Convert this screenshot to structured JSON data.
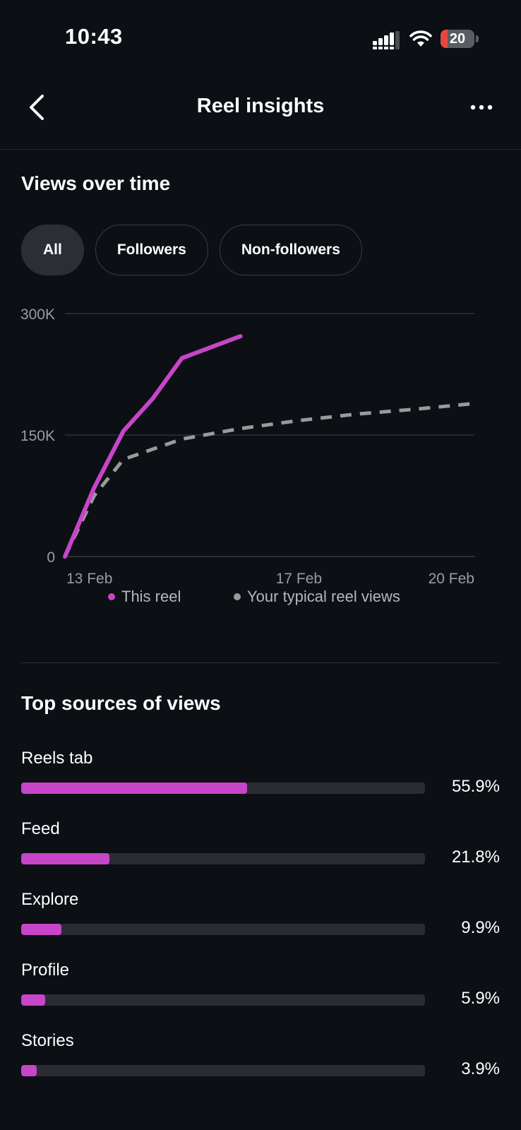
{
  "status_bar": {
    "time": "10:43",
    "battery_level": "20",
    "battery_fraction": 0.2,
    "icons": [
      "signal-icon",
      "wifi-icon",
      "battery-icon"
    ]
  },
  "header": {
    "title": "Reel insights",
    "back_icon": "chevron-left-icon",
    "more_icon": "more-horizontal-icon"
  },
  "views_section": {
    "title": "Views over time",
    "filters": [
      {
        "label": "All",
        "selected": true
      },
      {
        "label": "Followers",
        "selected": false
      },
      {
        "label": "Non-followers",
        "selected": false
      }
    ]
  },
  "chart_data": {
    "type": "line",
    "y_ticks": [
      "300K",
      "150K",
      "0"
    ],
    "x_ticks": [
      "13 Feb",
      "17 Feb",
      "20 Feb"
    ],
    "ylim": [
      0,
      300000
    ],
    "xlim": [
      13,
      20
    ],
    "grid": true,
    "legend_position": "bottom",
    "series": [
      {
        "name": "This reel",
        "color": "#c745c8",
        "style": "solid",
        "x": [
          13,
          13.5,
          14,
          14.5,
          15,
          16
        ],
        "y": [
          0,
          85000,
          155000,
          195000,
          245000,
          272000
        ]
      },
      {
        "name": "Your typical reel views",
        "color": "#9a9a9a",
        "style": "dashed",
        "x": [
          13,
          13.5,
          14,
          15,
          16,
          17,
          18,
          19,
          20
        ],
        "y": [
          0,
          75000,
          120000,
          145000,
          158000,
          168000,
          176000,
          182000,
          189000
        ]
      }
    ]
  },
  "sources_section": {
    "title": "Top sources of views",
    "accent_color": "#c745c8",
    "items": [
      {
        "label": "Reels tab",
        "percent": "55.9%",
        "value": 55.9
      },
      {
        "label": "Feed",
        "percent": "21.8%",
        "value": 21.8
      },
      {
        "label": "Explore",
        "percent": "9.9%",
        "value": 9.9
      },
      {
        "label": "Profile",
        "percent": "5.9%",
        "value": 5.9
      },
      {
        "label": "Stories",
        "percent": "3.9%",
        "value": 3.9
      }
    ]
  }
}
